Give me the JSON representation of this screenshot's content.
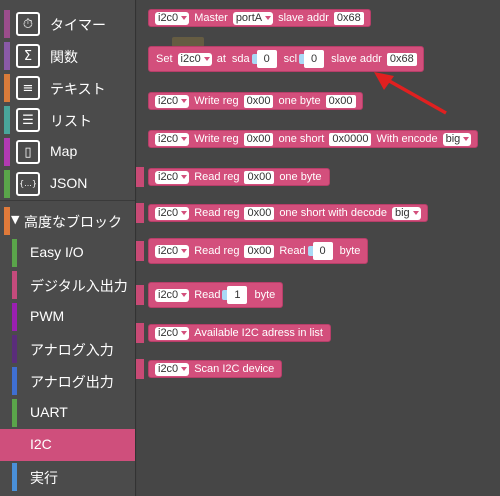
{
  "sidebar": {
    "categories": [
      {
        "label": "タイマー",
        "icon": "clock-icon",
        "glyph": "⏱",
        "color": "#9b4d8b"
      },
      {
        "label": "関数",
        "icon": "sigma-icon",
        "glyph": "Σ",
        "color": "#8a5aa8"
      },
      {
        "label": "テキスト",
        "icon": "text-icon",
        "glyph": "≡",
        "color": "#d97b3a"
      },
      {
        "label": "リスト",
        "icon": "list-icon",
        "glyph": "☰",
        "color": "#49a59b"
      },
      {
        "label": "Map",
        "icon": "book-icon",
        "glyph": "▯",
        "color": "#b23ab3"
      },
      {
        "label": "JSON",
        "icon": "braces-icon",
        "glyph": "{...}",
        "color": "#5aa54a"
      }
    ],
    "advanced_label": "高度なブロック",
    "sub_items": [
      {
        "label": "Easy I/O",
        "color": "#5aa54a"
      },
      {
        "label": "デジタル入出力",
        "color": "#c54b7c"
      },
      {
        "label": "PWM",
        "color": "#9a1fb1"
      },
      {
        "label": "アナログ入力",
        "color": "#5a2d7a"
      },
      {
        "label": "アナログ出力",
        "color": "#3f6fd1"
      },
      {
        "label": "UART",
        "color": "#5aa54a"
      },
      {
        "label": "I2C",
        "color": "#cf4f7c",
        "selected": true
      },
      {
        "label": "実行",
        "color": "#4a90d9"
      }
    ]
  },
  "blocks": {
    "b1": {
      "var": "i2c0",
      "t1": "Master",
      "port": "portA",
      "t2": "slave addr",
      "addr": "0x68"
    },
    "b2": {
      "t0": "Set",
      "var": "i2c0",
      "t1": "at",
      "t2": "sda",
      "sda": "0",
      "t3": "scl",
      "scl": "0",
      "t4": "slave addr",
      "addr": "0x68"
    },
    "b3": {
      "var": "i2c0",
      "t1": "Write reg",
      "reg": "0x00",
      "t2": "one byte",
      "val": "0x00"
    },
    "b4": {
      "var": "i2c0",
      "t1": "Write reg",
      "reg": "0x00",
      "t2": "one short",
      "val": "0x0000",
      "t3": "With encode",
      "enc": "big"
    },
    "b5": {
      "var": "i2c0",
      "t1": "Read reg",
      "reg": "0x00",
      "t2": "one byte"
    },
    "b6": {
      "var": "i2c0",
      "t1": "Read reg",
      "reg": "0x00",
      "t2": "one short with decode",
      "enc": "big"
    },
    "b7": {
      "var": "i2c0",
      "t1": "Read reg",
      "reg": "0x00",
      "t2": "Read",
      "n": "0",
      "t3": "byte"
    },
    "b8": {
      "var": "i2c0",
      "t1": "Read",
      "n": "1",
      "t2": "byte"
    },
    "b9": {
      "var": "i2c0",
      "t1": "Available I2C adress in list"
    },
    "b10": {
      "var": "i2c0",
      "t1": "Scan I2C device"
    }
  },
  "annotation": {
    "arrow_color": "#e02020"
  }
}
